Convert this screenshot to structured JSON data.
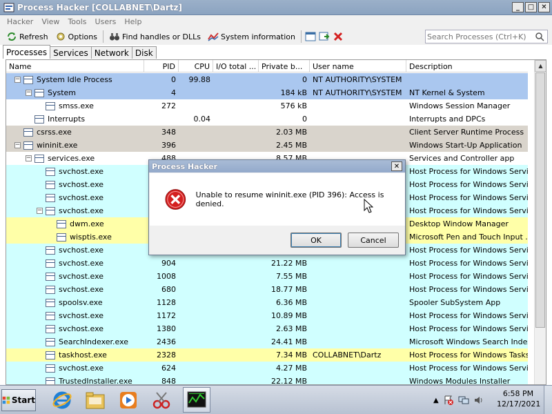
{
  "window": {
    "title": "Process Hacker [COLLABNET\\Dartz]"
  },
  "menu": [
    "Hacker",
    "View",
    "Tools",
    "Users",
    "Help"
  ],
  "toolbar": {
    "refresh": "Refresh",
    "options": "Options",
    "find_handles": "Find handles or DLLs",
    "system_info": "System information",
    "search_placeholder": "Search Processes (Ctrl+K)"
  },
  "tabs": [
    "Processes",
    "Services",
    "Network",
    "Disk"
  ],
  "columns": [
    "Name",
    "PID",
    "CPU",
    "I/O total ...",
    "Private b...",
    "User name",
    "Description"
  ],
  "processes": [
    {
      "name": "System Idle Process",
      "pid": "0",
      "cpu": "99.88",
      "io": "",
      "priv": "0",
      "user": "NT AUTHORITY\\SYSTEM",
      "desc": "",
      "level": 0,
      "expander": "−",
      "color": "#aac7ef"
    },
    {
      "name": "System",
      "pid": "4",
      "cpu": "",
      "io": "",
      "priv": "184 kB",
      "user": "NT AUTHORITY\\SYSTEM",
      "desc": "NT Kernel & System",
      "level": 1,
      "expander": "−",
      "color": "#aac7ef"
    },
    {
      "name": "smss.exe",
      "pid": "272",
      "cpu": "",
      "io": "",
      "priv": "576 kB",
      "user": "",
      "desc": "Windows Session Manager",
      "level": 2,
      "expander": "",
      "color": "#ffffff"
    },
    {
      "name": "Interrupts",
      "pid": "",
      "cpu": "0.04",
      "io": "",
      "priv": "0",
      "user": "",
      "desc": "Interrupts and DPCs",
      "level": 1,
      "expander": "",
      "color": "#ffffff"
    },
    {
      "name": "csrss.exe",
      "pid": "348",
      "cpu": "",
      "io": "",
      "priv": "2.03 MB",
      "user": "",
      "desc": "Client Server Runtime Process",
      "level": 0,
      "expander": "",
      "color": "#d9d4cc"
    },
    {
      "name": "wininit.exe",
      "pid": "396",
      "cpu": "",
      "io": "",
      "priv": "2.45 MB",
      "user": "",
      "desc": "Windows Start-Up Application",
      "level": 0,
      "expander": "−",
      "color": "#d9d4cc"
    },
    {
      "name": "services.exe",
      "pid": "488",
      "cpu": "",
      "io": "",
      "priv": "8.57 MB",
      "user": "",
      "desc": "Services and Controller app",
      "level": 1,
      "expander": "−",
      "color": "#ffffff"
    },
    {
      "name": "svchost.exe",
      "pid": "",
      "cpu": "",
      "io": "",
      "priv": "",
      "user": "",
      "desc": "Host Process for Windows Services",
      "level": 2,
      "expander": "",
      "color": "#d0ffff"
    },
    {
      "name": "svchost.exe",
      "pid": "",
      "cpu": "",
      "io": "",
      "priv": "",
      "user": "",
      "desc": "Host Process for Windows Services",
      "level": 2,
      "expander": "",
      "color": "#d0ffff"
    },
    {
      "name": "svchost.exe",
      "pid": "",
      "cpu": "",
      "io": "",
      "priv": "",
      "user": "",
      "desc": "Host Process for Windows Services",
      "level": 2,
      "expander": "",
      "color": "#d0ffff"
    },
    {
      "name": "svchost.exe",
      "pid": "",
      "cpu": "",
      "io": "",
      "priv": "",
      "user": "",
      "desc": "Host Process for Windows Services",
      "level": 2,
      "expander": "−",
      "color": "#d0ffff"
    },
    {
      "name": "dwm.exe",
      "pid": "",
      "cpu": "",
      "io": "",
      "priv": "",
      "user": "",
      "desc": "Desktop Window Manager",
      "level": 3,
      "expander": "",
      "color": "#ffffa8"
    },
    {
      "name": "wisptis.exe",
      "pid": "",
      "cpu": "",
      "io": "",
      "priv": "",
      "user": "",
      "desc": "Microsoft Pen and Touch Input ...",
      "level": 3,
      "expander": "",
      "color": "#ffffa8"
    },
    {
      "name": "svchost.exe",
      "pid": "",
      "cpu": "",
      "io": "",
      "priv": "",
      "user": "",
      "desc": "Host Process for Windows Services",
      "level": 2,
      "expander": "",
      "color": "#d0ffff"
    },
    {
      "name": "svchost.exe",
      "pid": "904",
      "cpu": "",
      "io": "",
      "priv": "21.22 MB",
      "user": "",
      "desc": "Host Process for Windows Services",
      "level": 2,
      "expander": "",
      "color": "#d0ffff"
    },
    {
      "name": "svchost.exe",
      "pid": "1008",
      "cpu": "",
      "io": "",
      "priv": "7.55 MB",
      "user": "",
      "desc": "Host Process for Windows Services",
      "level": 2,
      "expander": "",
      "color": "#d0ffff"
    },
    {
      "name": "svchost.exe",
      "pid": "680",
      "cpu": "",
      "io": "",
      "priv": "18.77 MB",
      "user": "",
      "desc": "Host Process for Windows Services",
      "level": 2,
      "expander": "",
      "color": "#d0ffff"
    },
    {
      "name": "spoolsv.exe",
      "pid": "1128",
      "cpu": "",
      "io": "",
      "priv": "6.36 MB",
      "user": "",
      "desc": "Spooler SubSystem App",
      "level": 2,
      "expander": "",
      "color": "#d0ffff"
    },
    {
      "name": "svchost.exe",
      "pid": "1172",
      "cpu": "",
      "io": "",
      "priv": "10.89 MB",
      "user": "",
      "desc": "Host Process for Windows Services",
      "level": 2,
      "expander": "",
      "color": "#d0ffff"
    },
    {
      "name": "svchost.exe",
      "pid": "1380",
      "cpu": "",
      "io": "",
      "priv": "2.63 MB",
      "user": "",
      "desc": "Host Process for Windows Services",
      "level": 2,
      "expander": "",
      "color": "#d0ffff"
    },
    {
      "name": "SearchIndexer.exe",
      "pid": "2436",
      "cpu": "",
      "io": "",
      "priv": "24.41 MB",
      "user": "",
      "desc": "Microsoft Windows Search Indexer",
      "level": 2,
      "expander": "",
      "color": "#d0ffff"
    },
    {
      "name": "taskhost.exe",
      "pid": "2328",
      "cpu": "",
      "io": "",
      "priv": "7.34 MB",
      "user": "COLLABNET\\Dartz",
      "desc": "Host Process for Windows Tasks",
      "level": 2,
      "expander": "",
      "color": "#ffffa8"
    },
    {
      "name": "svchost.exe",
      "pid": "624",
      "cpu": "",
      "io": "",
      "priv": "4.27 MB",
      "user": "",
      "desc": "Host Process for Windows Services",
      "level": 2,
      "expander": "",
      "color": "#d0ffff"
    },
    {
      "name": "TrustedInstaller.exe",
      "pid": "848",
      "cpu": "",
      "io": "",
      "priv": "22.12 MB",
      "user": "",
      "desc": "Windows Modules Installer",
      "level": 2,
      "expander": "",
      "color": "#d0ffff"
    }
  ],
  "dialog": {
    "title": "Process Hacker",
    "message": "Unable to resume wininit.exe (PID 396): Access is denied.",
    "ok": "OK",
    "cancel": "Cancel"
  },
  "taskbar": {
    "start": "Start",
    "time": "6:58 PM",
    "date": "12/17/2021"
  }
}
